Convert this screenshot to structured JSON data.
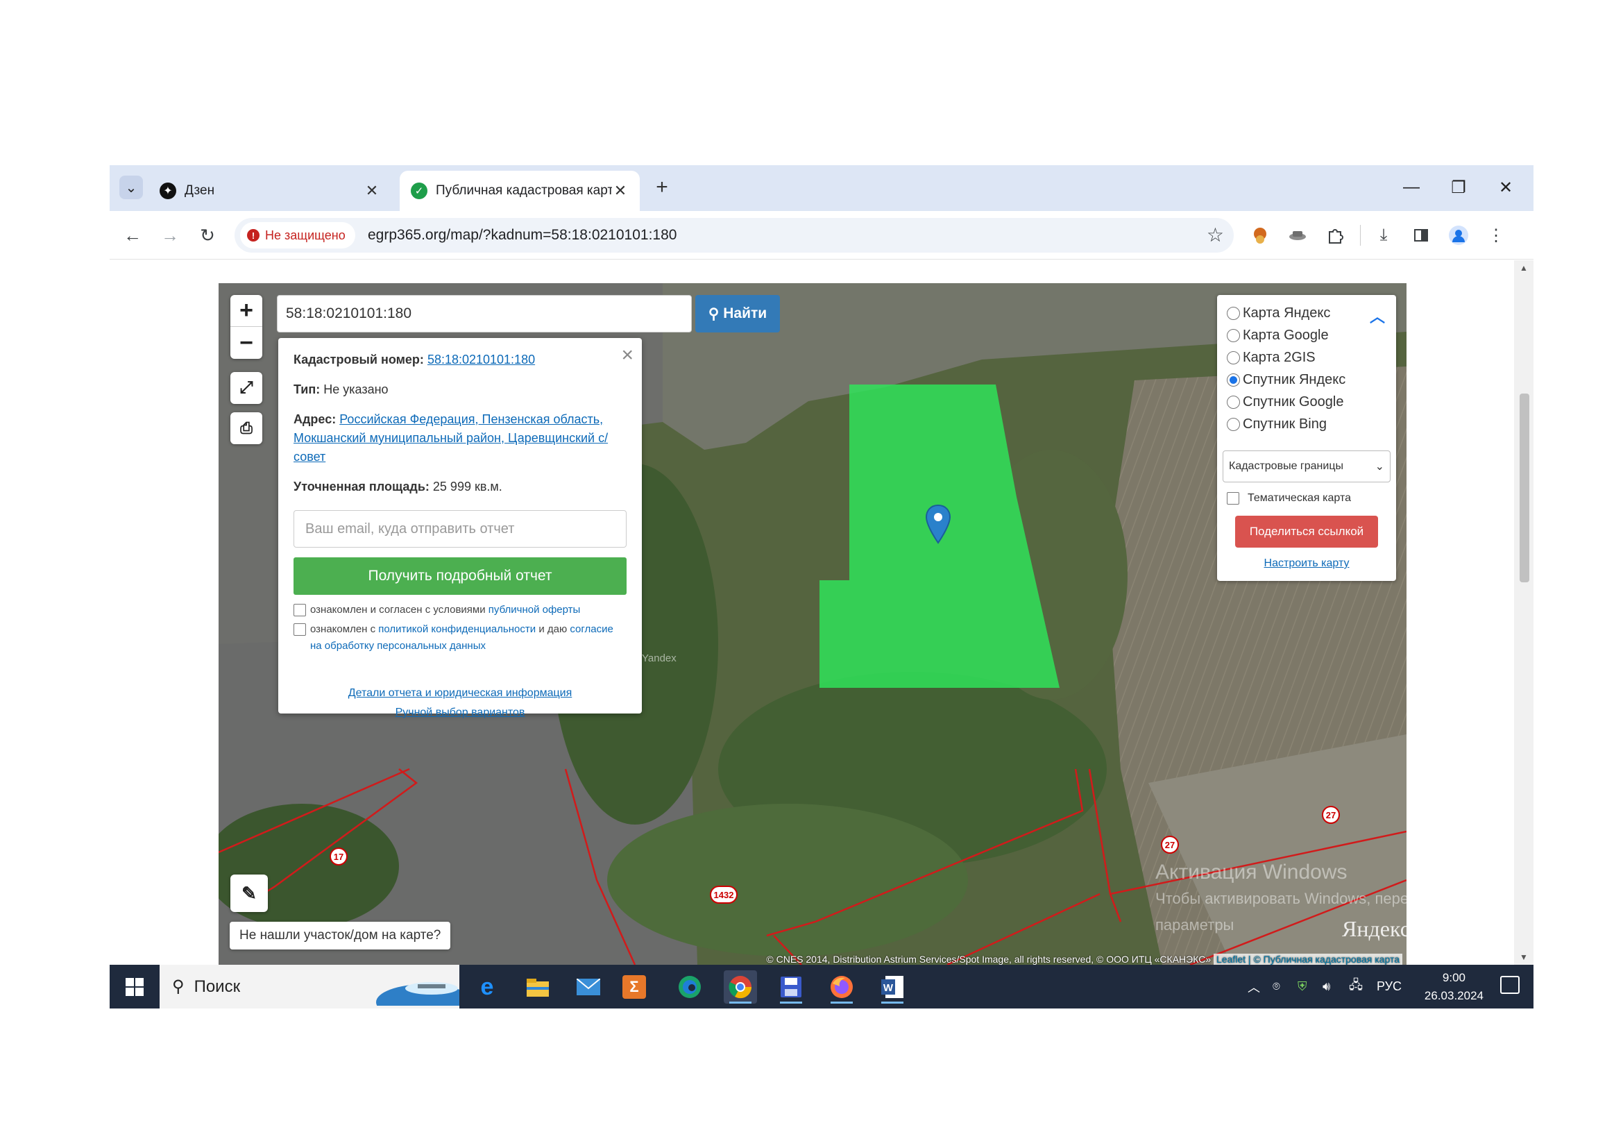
{
  "browser": {
    "tabs": [
      {
        "title": "Дзен",
        "active": false,
        "icon": "dzen-icon"
      },
      {
        "title": "Публичная кадастровая карта",
        "active": true,
        "icon": "check-shield-icon"
      }
    ],
    "security_label": "Не защищено",
    "url": "egrp365.org/map/?kadnum=58:18:0210101:180"
  },
  "map": {
    "search_value": "58:18:0210101:180",
    "search_button": "Найти",
    "popup": {
      "cadastral_label": "Кадастровый номер:",
      "cadastral_value": "58:18:0210101:180",
      "type_label": "Тип:",
      "type_value": "Не указано",
      "address_label": "Адрес:",
      "address_value": "Российская Федерация, Пензенская область, Мокшанский муниципальный район, Царевщинский с/совет",
      "area_label": "Уточненная площадь:",
      "area_value": "25 999 кв.м.",
      "email_placeholder": "Ваш email, куда отправить отчет",
      "report_button": "Получить подробный отчет",
      "consent1_text": "ознакомлен и согласен с условиями",
      "consent1_link": "публичной оферты",
      "consent2_text": "ознакомлен с",
      "consent2_link": "политикой конфиденциальности",
      "consent2_text2": "и даю",
      "consent2_link2": "согласие на обработку персональных данных",
      "details_link": "Детали отчета и юридическая информация",
      "manual_link": "Ручной выбор вариантов"
    },
    "layers": {
      "options": [
        {
          "label": "Карта Яндекс",
          "selected": false
        },
        {
          "label": "Карта Google",
          "selected": false
        },
        {
          "label": "Карта 2GIS",
          "selected": false
        },
        {
          "label": "Спутник Яндекс",
          "selected": true
        },
        {
          "label": "Спутник Google",
          "selected": false
        },
        {
          "label": "Спутник Bing",
          "selected": false
        }
      ],
      "overlay_select": "Кадастровые границы",
      "thematic_label": "Тематическая карта",
      "share_button": "Поделиться ссылкой",
      "configure_link": "Настроить карту"
    },
    "not_found_label": "Не нашли участок/дом на карте?",
    "road_labels": [
      "17",
      "1432",
      "27",
      "27"
    ],
    "attribution_text": "© CNES 2014, Distribution Astrium Services/Spot Image, all rights reserved, © ООО ИТЦ «СКАНЭКС»",
    "attribution_leaflet": "Leaflet",
    "attribution_pkk": "© Публичная кадастровая карта",
    "yandex_logo": "Яндекс",
    "watermark_yandex": "Yandex",
    "windows_activation_line1": "Активация Windows",
    "windows_activation_line2": "Чтобы активировать Windows, перейдите в",
    "windows_activation_line3": "параметры",
    "parcel_color": "#2ee65a"
  },
  "taskbar": {
    "search_placeholder": "Поиск",
    "language": "РУС",
    "time": "9:00",
    "date": "26.03.2024"
  }
}
